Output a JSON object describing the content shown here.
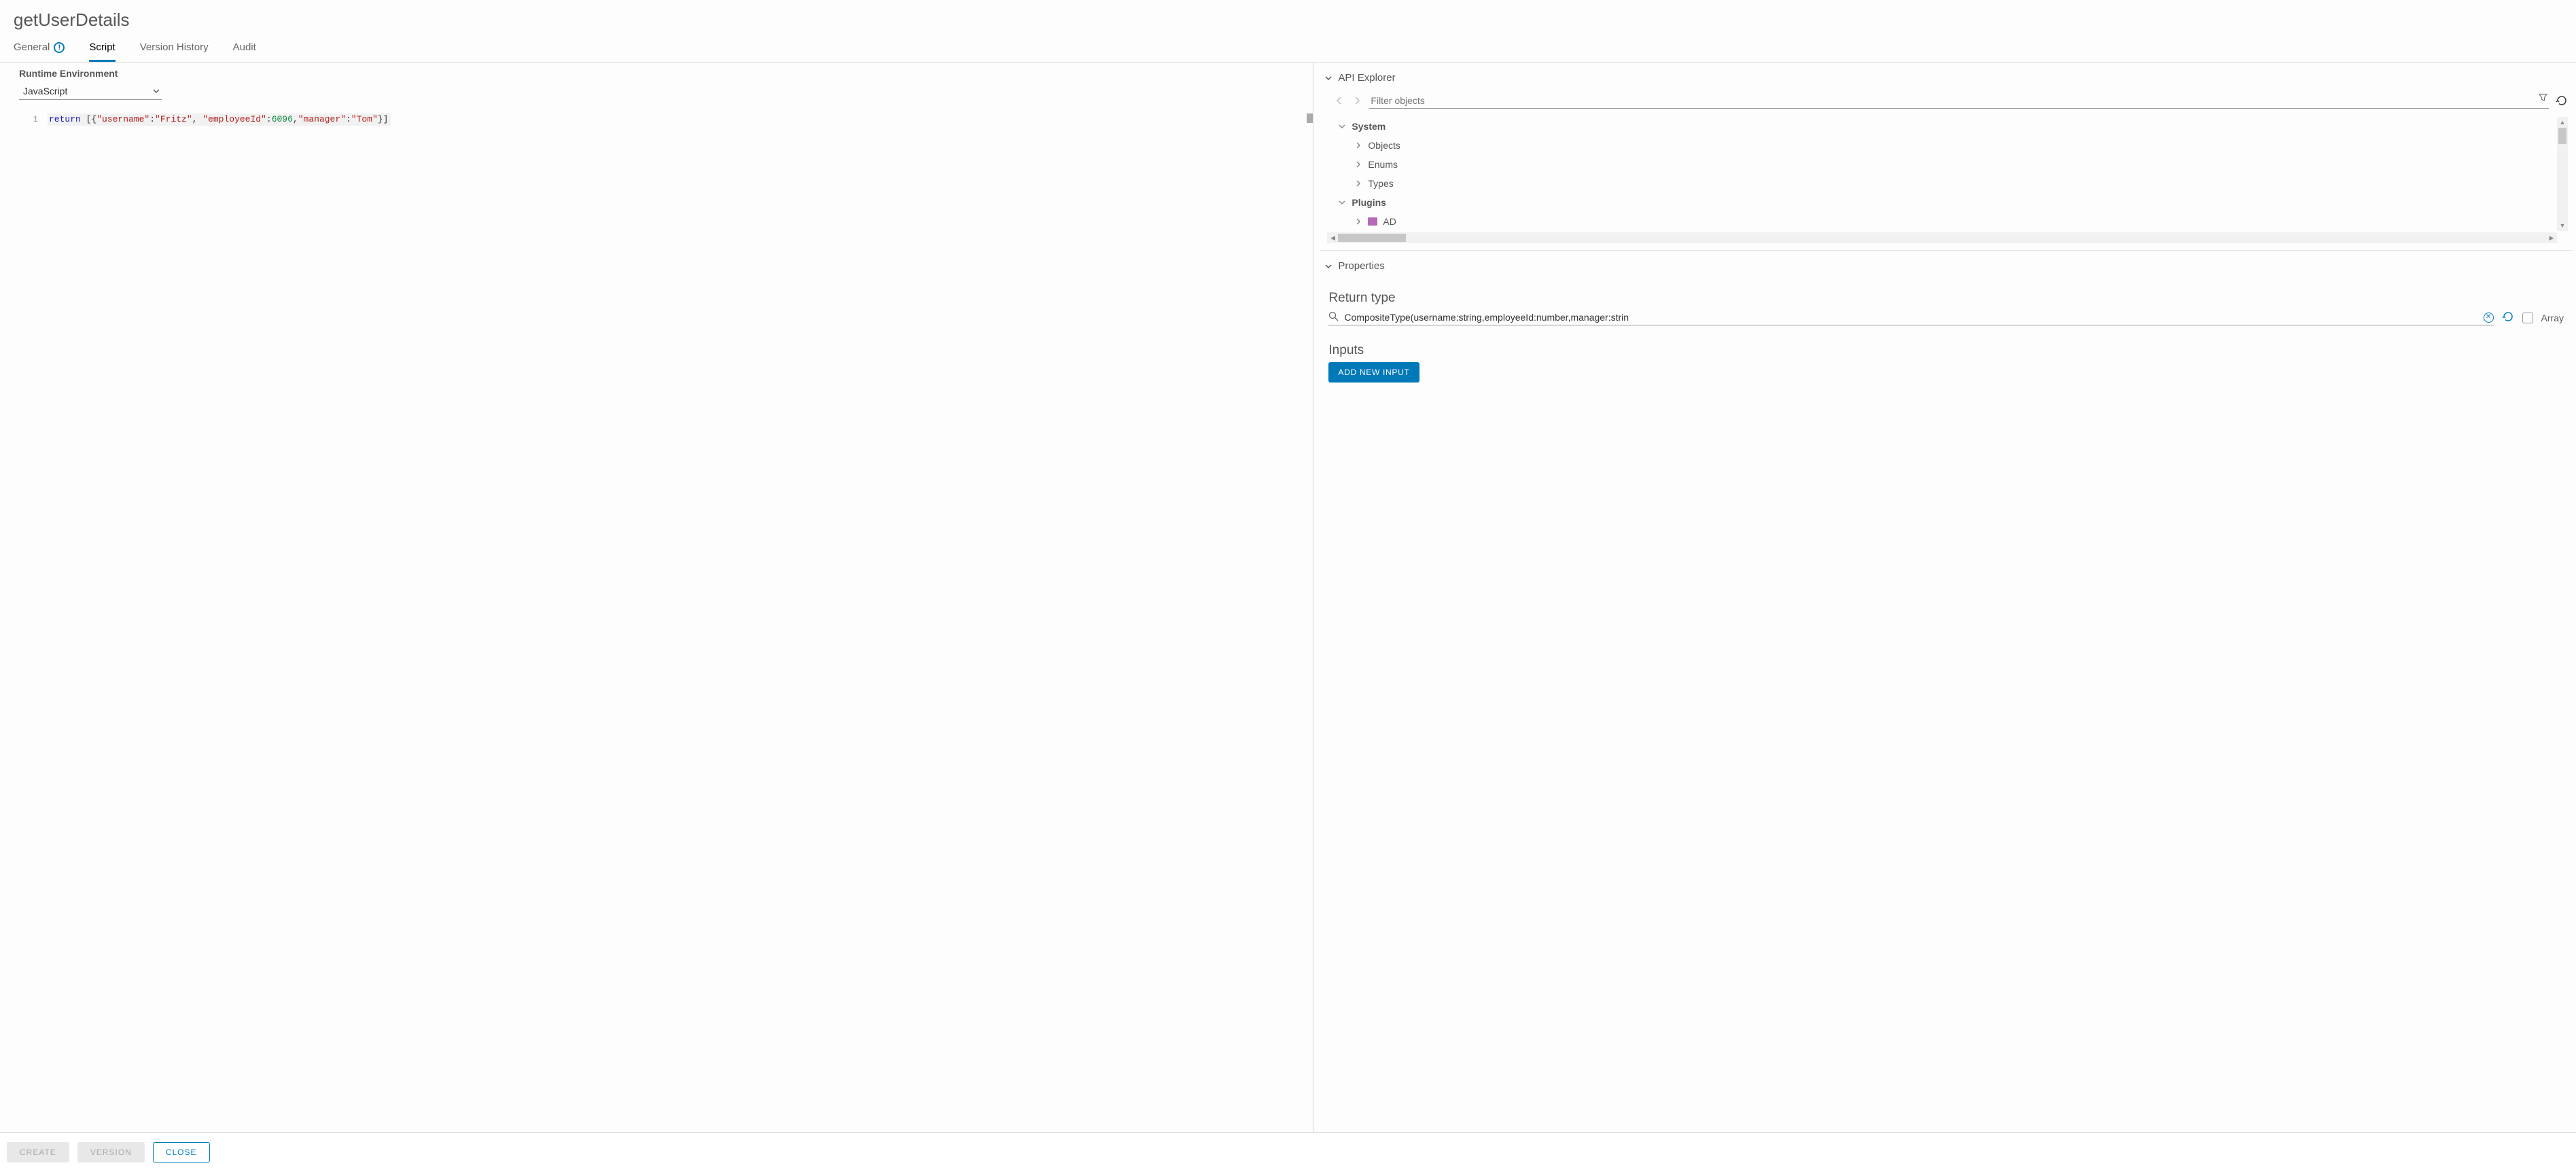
{
  "header": {
    "title": "getUserDetails"
  },
  "tabs": {
    "general": "General",
    "script": "Script",
    "version_history": "Version History",
    "audit": "Audit"
  },
  "runtime": {
    "label": "Runtime Environment",
    "selected": "JavaScript"
  },
  "editor": {
    "line_number": "1",
    "tok_return": "return",
    "tok_space_open": " [{",
    "tok_key_username": "\"username\"",
    "tok_colon1": ":",
    "tok_val_username": "\"Fritz\"",
    "tok_comma1": ", ",
    "tok_key_employee": "\"employeeId\"",
    "tok_colon2": ":",
    "tok_val_employee": "6096",
    "tok_comma2": ",",
    "tok_key_manager": "\"manager\"",
    "tok_colon3": ":",
    "tok_val_manager": "\"Tom\"",
    "tok_close": "}]"
  },
  "api_explorer": {
    "heading": "API Explorer",
    "filter_placeholder": "Filter objects",
    "tree": {
      "system": "System",
      "objects": "Objects",
      "enums": "Enums",
      "types": "Types",
      "plugins": "Plugins",
      "ad": "AD"
    }
  },
  "properties": {
    "heading": "Properties",
    "return_type_label": "Return type",
    "return_type_value": "CompositeType(username:string,employeeId:number,manager:strin",
    "array_label": "Array",
    "inputs_label": "Inputs",
    "add_input_btn": "ADD NEW INPUT"
  },
  "footer": {
    "create": "CREATE",
    "version": "VERSION",
    "close": "CLOSE"
  }
}
